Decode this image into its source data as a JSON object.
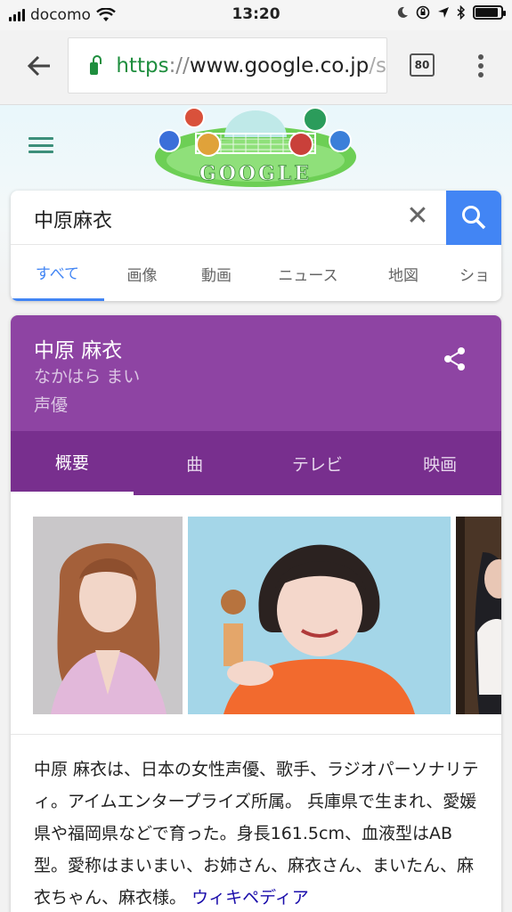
{
  "status_bar": {
    "carrier": "docomo",
    "time": "13:20",
    "battery_level": 0.9
  },
  "url_bar": {
    "scheme": "https",
    "separator": "://",
    "host": "www.google.co.jp",
    "rest": "/s",
    "tab_count": "80"
  },
  "search": {
    "query": "中原麻衣",
    "tabs": [
      "すべて",
      "画像",
      "動画",
      "ニュース",
      "地図",
      "ショ"
    ],
    "active_tab": 0
  },
  "doodle": {
    "text": "GOOGLE"
  },
  "knowledge_panel": {
    "name": "中原 麻衣",
    "reading": "なかはら まい",
    "type": "声優",
    "tabs": [
      "概要",
      "曲",
      "テレビ",
      "映画"
    ],
    "active_tab": 0,
    "description": "中原 麻衣は、日本の女性声優、歌手、ラジオパーソナリティ。アイムエンタープライズ所属。 兵庫県で生まれ、愛媛県や福岡県などで育った。身長161.5cm、血液型はAB型。愛称はまいまい、お姉さん、麻衣さん、まいたん、麻衣ちゃん、麻衣様。",
    "source_link": "ウィキペディア"
  },
  "colors": {
    "panel_header": "#8e44a3",
    "panel_tabs": "#782f8e",
    "search_blue": "#4285f4",
    "lock_green": "#1e8e3e"
  },
  "icons": [
    "wifi-icon",
    "moon-icon",
    "orientation-lock-icon",
    "location-icon",
    "bluetooth-icon",
    "battery-icon",
    "back-arrow-icon",
    "lock-icon",
    "tabs-icon",
    "more-vert-icon",
    "hamburger-icon",
    "clear-icon",
    "search-icon",
    "share-icon"
  ]
}
